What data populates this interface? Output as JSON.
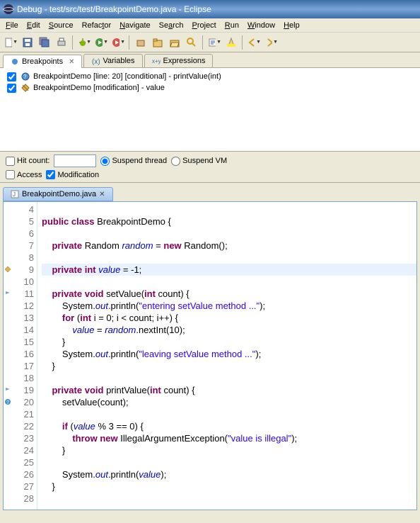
{
  "title": "Debug - test/src/test/BreakpointDemo.java - Eclipse",
  "menu": [
    "File",
    "Edit",
    "Source",
    "Refactor",
    "Navigate",
    "Search",
    "Project",
    "Run",
    "Window",
    "Help"
  ],
  "tabs": {
    "breakpoints": "Breakpoints",
    "variables": "Variables",
    "expressions": "Expressions"
  },
  "breakpoints": [
    "BreakpointDemo [line: 20] [conditional] - printValue(int)",
    "BreakpointDemo [modification] - value"
  ],
  "options": {
    "hitcount_label": "Hit count:",
    "hitcount_value": "",
    "suspend_thread": "Suspend thread",
    "suspend_vm": "Suspend VM",
    "access": "Access",
    "modification": "Modification"
  },
  "editor_tab": "BreakpointDemo.java",
  "code": {
    "lines": [
      {
        "n": 4,
        "html": ""
      },
      {
        "n": 5,
        "html": "<span class='kw'>public</span> <span class='kw'>class</span> BreakpointDemo {"
      },
      {
        "n": 6,
        "html": ""
      },
      {
        "n": 7,
        "html": "    <span class='kw'>private</span> Random <span class='fld'>random</span> = <span class='kw'>new</span> Random();"
      },
      {
        "n": 8,
        "html": ""
      },
      {
        "n": 9,
        "html": "    <span class='kw'>private</span> <span class='kw'>int</span> <span class='fld'>value</span> = -1;",
        "hl": true
      },
      {
        "n": 10,
        "html": ""
      },
      {
        "n": 11,
        "html": "    <span class='kw'>private</span> <span class='kw'>void</span> setValue(<span class='kw'>int</span> count) {"
      },
      {
        "n": 12,
        "html": "        System.<span class='fld'>out</span>.println(<span class='str'>\"entering setValue method ...\"</span>);"
      },
      {
        "n": 13,
        "html": "        <span class='kw'>for</span> (<span class='kw'>int</span> i = 0; i &lt; count; i++) {"
      },
      {
        "n": 14,
        "html": "            <span class='fld'>value</span> = <span class='fld'>random</span>.nextInt(10);"
      },
      {
        "n": 15,
        "html": "        }"
      },
      {
        "n": 16,
        "html": "        System.<span class='fld'>out</span>.println(<span class='str'>\"leaving setValue method ...\"</span>);"
      },
      {
        "n": 17,
        "html": "    }"
      },
      {
        "n": 18,
        "html": ""
      },
      {
        "n": 19,
        "html": "    <span class='kw'>private</span> <span class='kw'>void</span> printValue(<span class='kw'>int</span> count) {"
      },
      {
        "n": 20,
        "html": "        setValue(count);"
      },
      {
        "n": 21,
        "html": ""
      },
      {
        "n": 22,
        "html": "        <span class='kw'>if</span> (<span class='fld'>value</span> % 3 == 0) {"
      },
      {
        "n": 23,
        "html": "            <span class='kw'>throw</span> <span class='kw'>new</span> IllegalArgumentException(<span class='str'>\"value is illegal\"</span>);"
      },
      {
        "n": 24,
        "html": "        }"
      },
      {
        "n": 25,
        "html": ""
      },
      {
        "n": 26,
        "html": "        System.<span class='fld'>out</span>.println(<span class='fld'>value</span>);"
      },
      {
        "n": 27,
        "html": "    }"
      },
      {
        "n": 28,
        "html": ""
      }
    ]
  }
}
